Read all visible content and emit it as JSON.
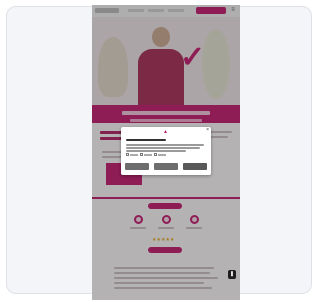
{
  "colors": {
    "brand": "#c0176c",
    "card_background": "#f4f5f8",
    "overlay": "rgba(40,40,40,0.33)"
  },
  "icons": {
    "logo": "brand-logo",
    "check": "checkmark-icon",
    "close": "close-icon",
    "chat": "chat-icon",
    "menu": "menu-icon",
    "stars": "star-rating-icon"
  },
  "hero": {
    "check_glyph": "✓"
  },
  "rating": {
    "stars": "★★★★★"
  },
  "modal": {
    "close_glyph": "×",
    "logo_glyph": "▲"
  },
  "nav": {
    "menu_glyph": "≡"
  },
  "chat": {
    "glyph": "❚"
  }
}
